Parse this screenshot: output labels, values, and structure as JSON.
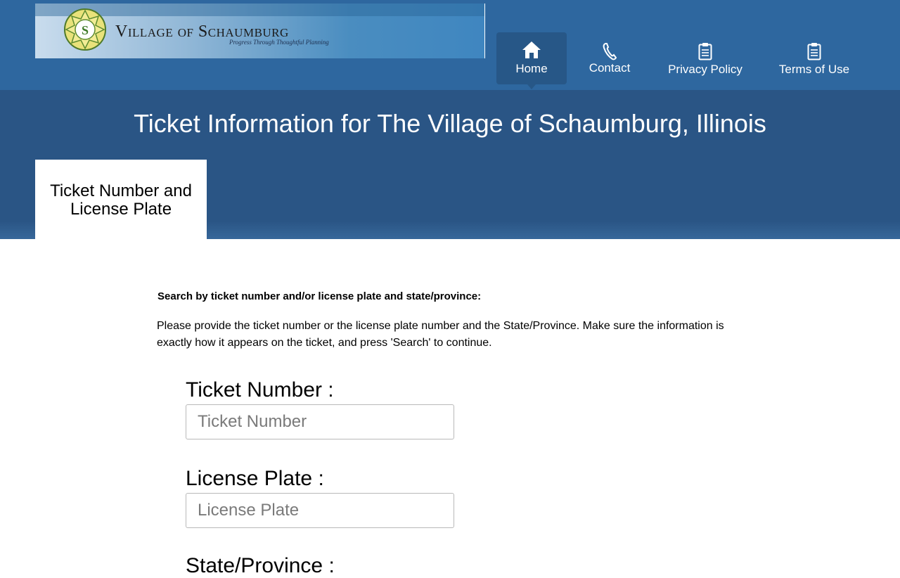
{
  "header": {
    "logo_title": "Village of Schaumburg",
    "logo_tagline": "Progress Through Thoughtful Planning",
    "nav": [
      {
        "label": "Home",
        "icon": "home-icon",
        "active": true
      },
      {
        "label": "Contact",
        "icon": "phone-icon",
        "active": false
      },
      {
        "label": "Privacy Policy",
        "icon": "clipboard-icon",
        "active": false
      },
      {
        "label": "Terms of Use",
        "icon": "clipboard-icon",
        "active": false
      }
    ]
  },
  "band": {
    "title": "Ticket Information for The Village of Schaumburg, Illinois",
    "tab_label": "Ticket Number and License Plate"
  },
  "form": {
    "heading": "Search by ticket number and/or license plate and state/province:",
    "instructions": "Please provide the ticket number or the license plate number and the State/Province. Make sure the information is exactly how it appears on the ticket, and press 'Search' to continue.",
    "ticket_label": "Ticket Number :",
    "ticket_placeholder": "Ticket Number",
    "ticket_value": "",
    "plate_label": "License Plate :",
    "plate_placeholder": "License Plate",
    "plate_value": "",
    "state_label": "State/Province :"
  },
  "colors": {
    "header_bg": "#2e679f",
    "band_bg": "#2a5585",
    "active_nav_bg": "#275787"
  }
}
